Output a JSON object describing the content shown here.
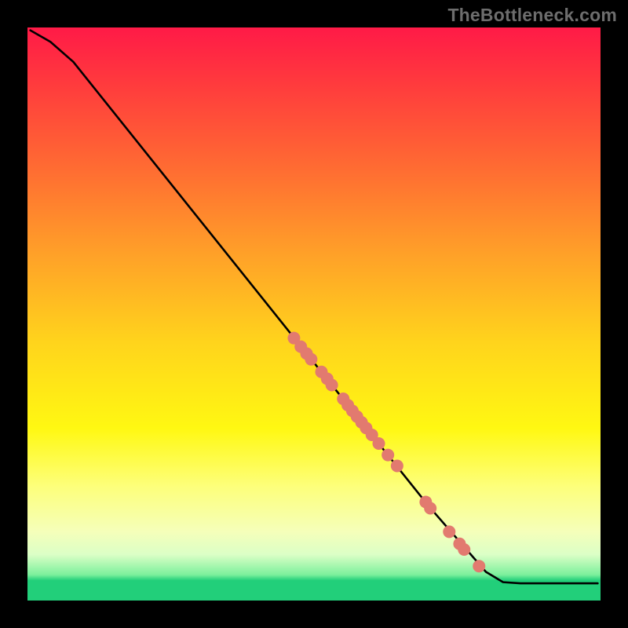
{
  "watermark": "TheBottleneck.com",
  "colors": {
    "background": "#000000",
    "curve_stroke": "#000000",
    "marker_fill": "#e27a6f",
    "marker_stroke": "#e27a6f",
    "gradient_top": "#ff1a47",
    "gradient_bottom": "#22cf7a"
  },
  "chart_data": {
    "type": "line",
    "title": "",
    "xlabel": "",
    "ylabel": "",
    "xlim": [
      0,
      100
    ],
    "ylim": [
      0,
      100
    ],
    "series": [
      {
        "name": "curve",
        "points": [
          {
            "x": 0.5,
            "y": 99.5
          },
          {
            "x": 4,
            "y": 97.5
          },
          {
            "x": 8,
            "y": 94
          },
          {
            "x": 12,
            "y": 89
          },
          {
            "x": 20,
            "y": 79
          },
          {
            "x": 30,
            "y": 66.5
          },
          {
            "x": 40,
            "y": 54
          },
          {
            "x": 50,
            "y": 41.5
          },
          {
            "x": 60,
            "y": 29
          },
          {
            "x": 70,
            "y": 16.5
          },
          {
            "x": 80,
            "y": 5
          },
          {
            "x": 83,
            "y": 3.2
          },
          {
            "x": 86,
            "y": 3.0
          },
          {
            "x": 99.5,
            "y": 3.0
          }
        ]
      }
    ],
    "markers": [
      {
        "x": 46.5,
        "y": 45.8
      },
      {
        "x": 47.7,
        "y": 44.3
      },
      {
        "x": 48.7,
        "y": 43.1
      },
      {
        "x": 49.5,
        "y": 42.1
      },
      {
        "x": 51.3,
        "y": 39.9
      },
      {
        "x": 52.3,
        "y": 38.7
      },
      {
        "x": 53.1,
        "y": 37.6
      },
      {
        "x": 55.1,
        "y": 35.2
      },
      {
        "x": 55.9,
        "y": 34.1
      },
      {
        "x": 56.7,
        "y": 33.1
      },
      {
        "x": 57.5,
        "y": 32.1
      },
      {
        "x": 58.3,
        "y": 31.1
      },
      {
        "x": 59.1,
        "y": 30.1
      },
      {
        "x": 60.1,
        "y": 28.9
      },
      {
        "x": 61.3,
        "y": 27.4
      },
      {
        "x": 62.9,
        "y": 25.4
      },
      {
        "x": 64.5,
        "y": 23.5
      },
      {
        "x": 69.5,
        "y": 17.2
      },
      {
        "x": 70.3,
        "y": 16.1
      },
      {
        "x": 73.6,
        "y": 12.0
      },
      {
        "x": 75.4,
        "y": 9.9
      },
      {
        "x": 76.2,
        "y": 8.9
      },
      {
        "x": 78.8,
        "y": 6.0
      }
    ]
  }
}
